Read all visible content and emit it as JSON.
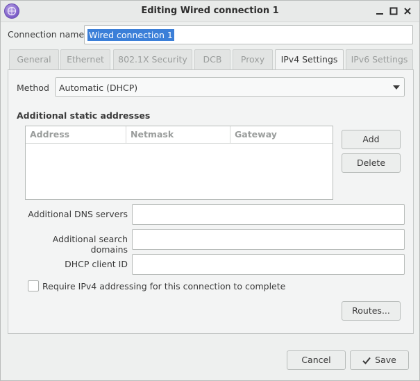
{
  "window": {
    "title": "Editing Wired connection 1"
  },
  "connection": {
    "label": "Connection name",
    "value": "Wired connection 1"
  },
  "tabs": [
    {
      "label": "General",
      "active": false
    },
    {
      "label": "Ethernet",
      "active": false
    },
    {
      "label": "802.1X Security",
      "active": false
    },
    {
      "label": "DCB",
      "active": false
    },
    {
      "label": "Proxy",
      "active": false
    },
    {
      "label": "IPv4 Settings",
      "active": true
    },
    {
      "label": "IPv6 Settings",
      "active": false
    }
  ],
  "ipv4": {
    "method_label": "Method",
    "method_value": "Automatic (DHCP)",
    "static_title": "Additional static addresses",
    "columns": [
      "Address",
      "Netmask",
      "Gateway"
    ],
    "add_label": "Add",
    "delete_label": "Delete",
    "dns_label": "Additional DNS servers",
    "dns_value": "",
    "search_label": "Additional search domains",
    "search_value": "",
    "dhcp_label": "DHCP client ID",
    "dhcp_value": "",
    "require_label": "Require IPv4 addressing for this connection to complete",
    "require_checked": false,
    "routes_label": "Routes..."
  },
  "footer": {
    "cancel_label": "Cancel",
    "save_label": "Save"
  },
  "icons": {
    "app": "network-manager-icon",
    "minimize": "minimize-icon",
    "maximize": "maximize-icon",
    "close": "close-icon",
    "dropdown": "chevron-down-icon",
    "save": "checkmark-icon"
  },
  "colors": {
    "selection": "#3b7fd8",
    "background": "#eef0ef"
  }
}
